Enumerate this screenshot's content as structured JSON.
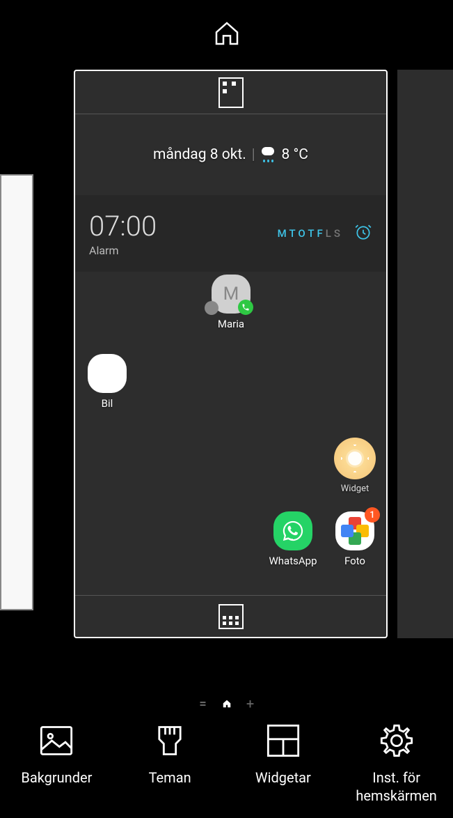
{
  "dateWeather": {
    "date": "måndag 8 okt.",
    "temperature": "8 °C"
  },
  "alarm": {
    "time": "07:00",
    "label": "Alarm",
    "days": [
      {
        "letter": "M",
        "active": true
      },
      {
        "letter": "T",
        "active": true
      },
      {
        "letter": "O",
        "active": true
      },
      {
        "letter": "T",
        "active": true
      },
      {
        "letter": "F",
        "active": true
      },
      {
        "letter": "L",
        "active": false
      },
      {
        "letter": "S",
        "active": false
      }
    ]
  },
  "apps": {
    "maria": {
      "label": "Maria",
      "initial": "M"
    },
    "bil": {
      "label": "Bil"
    },
    "widget": {
      "label": "Widget"
    },
    "whatsapp": {
      "label": "WhatsApp"
    },
    "foto": {
      "label": "Foto",
      "badge": "1"
    }
  },
  "toolbar": {
    "wallpapers": "Bakgrunder",
    "themes": "Teman",
    "widgets": "Widgetar",
    "settings": "Inst. för hemskärmen"
  }
}
